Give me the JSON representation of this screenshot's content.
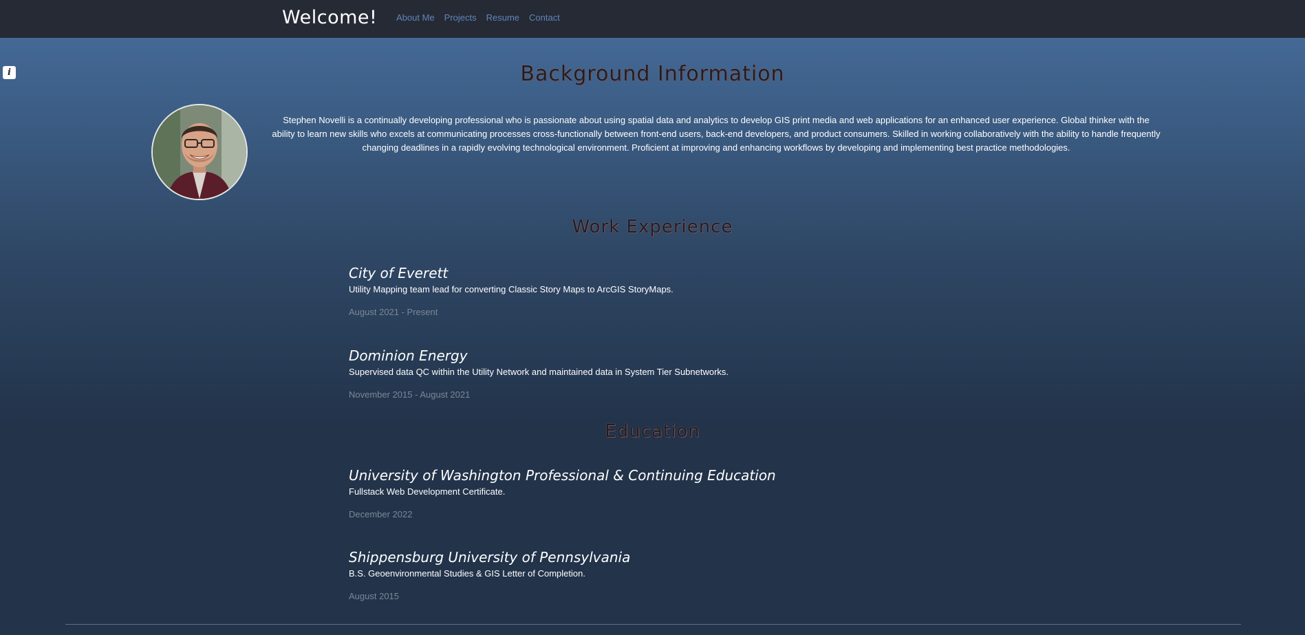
{
  "navbar": {
    "brand": "Welcome!",
    "links": [
      "About Me",
      "Projects",
      "Resume",
      "Contact"
    ]
  },
  "info_button": {
    "label": "i"
  },
  "background": {
    "heading": "Background Information",
    "bio": "Stephen Novelli is a continually developing professional who is passionate about using spatial data and analytics to develop GIS print media and web applications for an enhanced user experience. Global thinker with the ability to learn new skills who excels at communicating processes cross-functionally between front-end users, back-end developers, and product consumers. Skilled in working collaboratively with the ability to handle frequently changing deadlines in a rapidly evolving technological environment. Proficient at improving and enhancing workflows by developing and implementing best practice methodologies."
  },
  "work": {
    "heading": "Work Experience",
    "items": [
      {
        "title": "City of Everett",
        "description": "Utility Mapping team lead for converting Classic Story Maps to ArcGIS StoryMaps.",
        "dates": "August 2021 - Present"
      },
      {
        "title": "Dominion Energy",
        "description": "Supervised data QC within the Utility Network and maintained data in System Tier Subnetworks.",
        "dates": "November 2015 - August 2021"
      }
    ]
  },
  "education": {
    "heading": "Education",
    "items": [
      {
        "title": "University of Washington Professional & Continuing Education",
        "description": "Fullstack Web Development Certificate.",
        "dates": "December 2022"
      },
      {
        "title": "Shippensburg University of Pennsylvania",
        "description": "B.S. Geoenvironmental Studies & GIS Letter of Completion.",
        "dates": "August 2015"
      }
    ]
  },
  "colors": {
    "navbar_bg": "#262a35",
    "nav_link": "#5f86b8",
    "date_text": "#7c8796"
  }
}
